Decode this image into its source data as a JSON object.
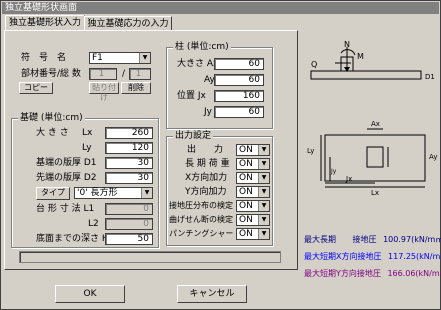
{
  "window": {
    "title": "独立基礎形状画面"
  },
  "tabs": [
    {
      "label": "独立基礎形状入力"
    },
    {
      "label": "独立基礎応力の入力"
    }
  ],
  "top": {
    "symbol_label": "符　号　名",
    "symbol_value": "F1",
    "member_label": "部材番号/総 数",
    "member_no": "1",
    "member_sep": "/",
    "member_total": "1",
    "copy_label": "コピー",
    "paste_label": "貼り付け",
    "delete_label": "削除"
  },
  "column": {
    "group_label": "柱 (単位:cm)",
    "fields": [
      {
        "label": "大きさ Ax",
        "value": "60"
      },
      {
        "label": "Ay",
        "value": "60"
      },
      {
        "label": "位置 Jx",
        "value": "160"
      },
      {
        "label": "Jy",
        "value": "60"
      }
    ]
  },
  "base": {
    "group_label": "基礎 (単位:cm)",
    "size_label": "大 き さ",
    "lx_label": "Lx",
    "lx_value": "260",
    "ly_label": "Ly",
    "ly_value": "120",
    "d1_label": "基端の版厚 D1",
    "d1_value": "30",
    "d2_label": "先端の版厚 D2",
    "d2_value": "30",
    "type_button": "タイプ",
    "type_value": "'0' 長方形",
    "trap_label": "台 形 寸 法 L1",
    "l1_value": "0",
    "l2_label": "L2",
    "l2_value": "0",
    "depth_label": "底面までの深さ H",
    "depth_value": "50"
  },
  "output": {
    "group_label": "出力設定",
    "items": [
      {
        "label": "出　　力",
        "value": "ON"
      },
      {
        "label": "長 期 荷 重",
        "value": "ON"
      },
      {
        "label": "X方向加力",
        "value": "ON"
      },
      {
        "label": "Y方向加力",
        "value": "ON"
      },
      {
        "label": "接地圧分布の検定",
        "value": "ON"
      },
      {
        "label": "曲げせん断の検定",
        "value": "ON"
      },
      {
        "label": "パンチングシャー",
        "value": "ON"
      }
    ]
  },
  "diagram": {
    "n": "N",
    "m": "M",
    "q": "Q",
    "d1": "D1",
    "ax": "Ax",
    "ay": "Ay",
    "ly": "Ly",
    "jy": "Jy",
    "jx": "Jx",
    "lx": "Lx"
  },
  "results": [
    {
      "label": "最大長期",
      "kind": "接地圧",
      "value": "100.97(kN/m㎡)",
      "color": "#000080"
    },
    {
      "label": "最大短期X方向接地圧",
      "kind": "",
      "value": "117.25(kN/m㎡)",
      "color": "#0000ff"
    },
    {
      "label": "最大短期Y方向接地圧",
      "kind": "",
      "value": "166.06(kN/m㎡)",
      "color": "#800080"
    }
  ],
  "buttons": {
    "ok": "OK",
    "cancel": "キャンセル"
  }
}
